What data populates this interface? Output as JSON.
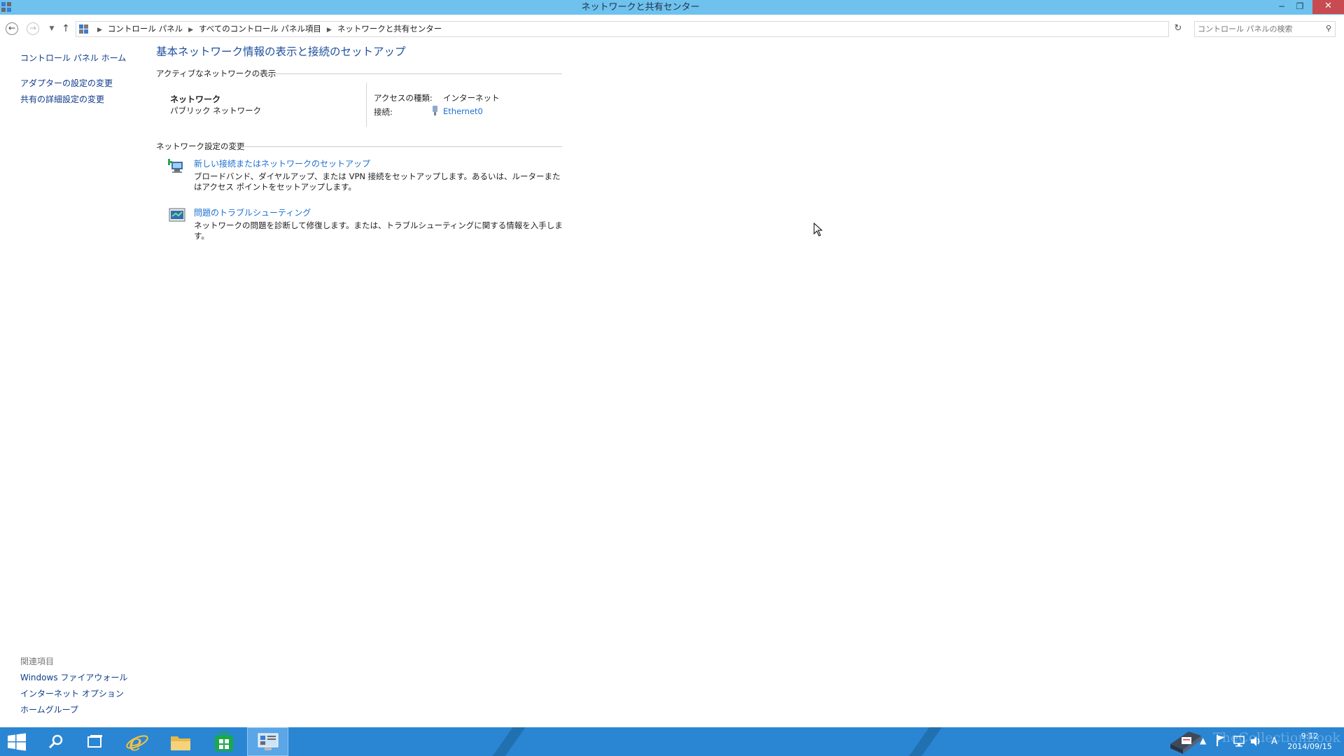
{
  "window": {
    "title": "ネットワークと共有センター",
    "min_glyph": "−",
    "max_glyph": "❐",
    "close_glyph": "✕"
  },
  "address": {
    "crumbs": [
      "コントロール パネル",
      "すべてのコントロール パネル項目",
      "ネットワークと共有センター"
    ],
    "search_placeholder": "コントロール パネルの検索"
  },
  "leftnav": {
    "items": [
      "コントロール パネル ホーム",
      "アダプターの設定の変更",
      "共有の詳細設定の変更"
    ],
    "see_also_title": "関連項目",
    "see_also": [
      "Windows ファイアウォール",
      "インターネット オプション",
      "ホームグループ"
    ]
  },
  "main": {
    "title": "基本ネットワーク情報の表示と接続のセットアップ",
    "active_header": "アクティブなネットワークの表示",
    "network_name": "ネットワーク",
    "network_category": "パブリック ネットワーク",
    "access_label": "アクセスの種類:",
    "access_value": "インターネット",
    "conn_label": "接続:",
    "conn_value": "Ethernet0",
    "change_header": "ネットワーク設定の変更",
    "tasks": [
      {
        "title": "新しい接続またはネットワークのセットアップ",
        "desc": "ブロードバンド、ダイヤルアップ、または VPN 接続をセットアップします。あるいは、ルーターまたはアクセス ポイントをセットアップします。"
      },
      {
        "title": "問題のトラブルシューティング",
        "desc": "ネットワークの問題を診断して修復します。または、トラブルシューティングに関する情報を入手します。"
      }
    ]
  },
  "taskbar": {
    "ime": "A",
    "time": "9:12",
    "date": "2014/09/15",
    "watermark": "TheCollectionBook"
  },
  "colors": {
    "titlebar": "#6fc1ee",
    "taskbar": "#2a86d3",
    "link": "#1d6fd1",
    "nav_link": "#0f3b8a",
    "title_text": "#1d4f9c"
  }
}
